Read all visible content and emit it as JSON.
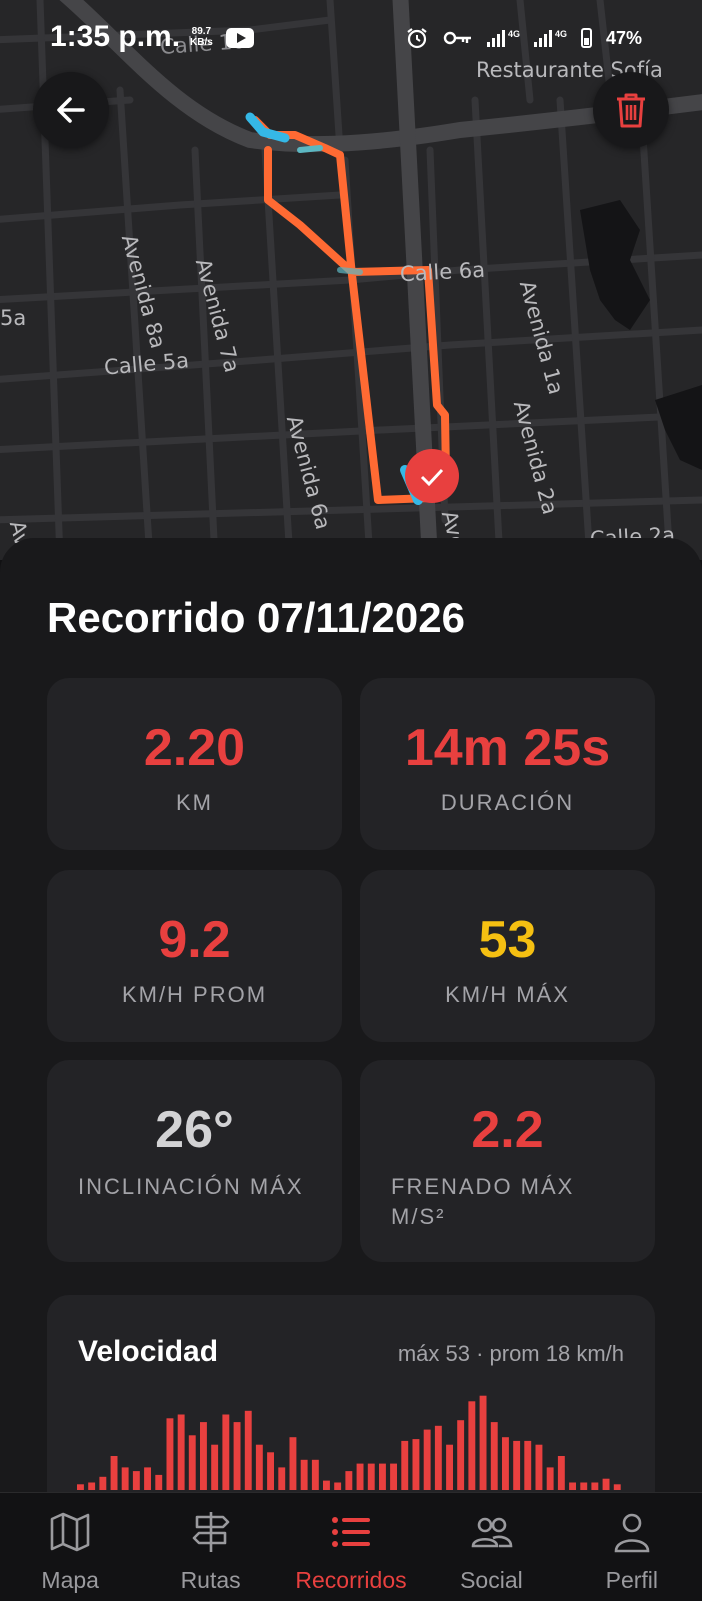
{
  "status_bar": {
    "time": "1:35 p.m.",
    "net_speed_value": "89.7",
    "net_speed_unit": "KB/s",
    "network_1": "4G",
    "network_2": "4G",
    "battery": "47%"
  },
  "map": {
    "labels": {
      "restaurant": "Restaurante Sofía",
      "calle_6a": "Calle 6a",
      "calle_5a": "Calle 5a",
      "avenida_8a": "Avenida 8a",
      "avenida_7a": "Avenida 7a",
      "avenida_6a": "Avenida 6a",
      "avenida_1a": "Avenida 1a",
      "avenida_2a": "Avenida 2a",
      "calle_2a": "Calle 2a",
      "calle_partial_top": "Calle 10",
      "edge_left": "5a",
      "avenida_partial_bottom": "Avenida",
      "edge_left_bottom": "Av"
    },
    "route_color": "#ff6a33",
    "start_color": "#35b8e6",
    "end_marker_color": "#e8403f"
  },
  "trip": {
    "title": "Recorrido 07/11/2026"
  },
  "stats": [
    {
      "value": "2.20",
      "label": "KM",
      "color": "#e8403f"
    },
    {
      "value": "14m 25s",
      "label": "DURACIÓN",
      "color": "#e8403f"
    },
    {
      "value": "9.2",
      "label": "KM/H PROM",
      "color": "#e8403f"
    },
    {
      "value": "53",
      "label": "KM/H MÁX",
      "color": "#f5c012"
    },
    {
      "value": "26°",
      "label": "INCLINACIÓN MÁX",
      "color": "#d2d2d4"
    },
    {
      "value": "2.2",
      "label": "FRENADO MÁX M/S²",
      "color": "#e8403f"
    }
  ],
  "speed_chart": {
    "title": "Velocidad",
    "summary": "máx 53 · prom 18 km/h",
    "bar_color": "#e8403f"
  },
  "chart_data": {
    "type": "bar",
    "title": "Velocidad",
    "xlabel": "",
    "ylabel": "",
    "ylim": [
      0,
      53
    ],
    "values": [
      3,
      4,
      7,
      18,
      12,
      10,
      12,
      8,
      38,
      40,
      29,
      36,
      24,
      40,
      36,
      42,
      24,
      20,
      12,
      28,
      16,
      16,
      5,
      4,
      10,
      14,
      14,
      14,
      14,
      26,
      27,
      32,
      34,
      24,
      37,
      47,
      50,
      36,
      28,
      26,
      26,
      24,
      12,
      18,
      4,
      4,
      4,
      6,
      3
    ]
  },
  "nav": [
    {
      "label": "Mapa",
      "icon": "map-icon",
      "active": false
    },
    {
      "label": "Rutas",
      "icon": "signpost-icon",
      "active": false
    },
    {
      "label": "Recorridos",
      "icon": "list-icon",
      "active": true
    },
    {
      "label": "Social",
      "icon": "people-icon",
      "active": false
    },
    {
      "label": "Perfil",
      "icon": "person-icon",
      "active": false
    }
  ]
}
